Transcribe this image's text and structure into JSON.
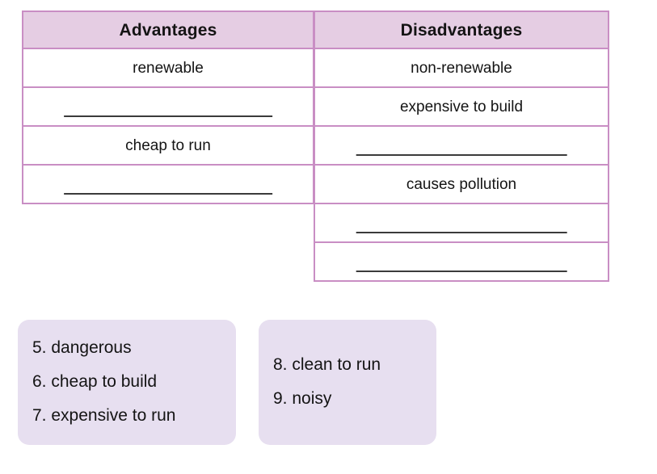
{
  "colors": {
    "table_border": "#c98ec4",
    "header_fill": "#e5cde3",
    "wordbank_fill": "#e7dff0",
    "text": "#141414",
    "answer_line": "#3b3b3b",
    "page_background": "#ffffff"
  },
  "table": {
    "columns": [
      {
        "header": "Advantages",
        "cells": [
          {
            "text": "renewable",
            "blank": false
          },
          {
            "text": "",
            "blank": true
          },
          {
            "text": "cheap to run",
            "blank": false
          },
          {
            "text": "",
            "blank": true
          }
        ]
      },
      {
        "header": "Disadvantages",
        "cells": [
          {
            "text": "non-renewable",
            "blank": false
          },
          {
            "text": "expensive to build",
            "blank": false
          },
          {
            "text": "",
            "blank": true
          },
          {
            "text": "causes pollution",
            "blank": false
          },
          {
            "text": "",
            "blank": true
          },
          {
            "text": "",
            "blank": true
          }
        ]
      }
    ]
  },
  "wordbanks": [
    {
      "items": [
        "5. dangerous",
        "6. cheap to build",
        "7. expensive to run"
      ]
    },
    {
      "items": [
        "8. clean to run",
        "9. noisy"
      ]
    }
  ]
}
